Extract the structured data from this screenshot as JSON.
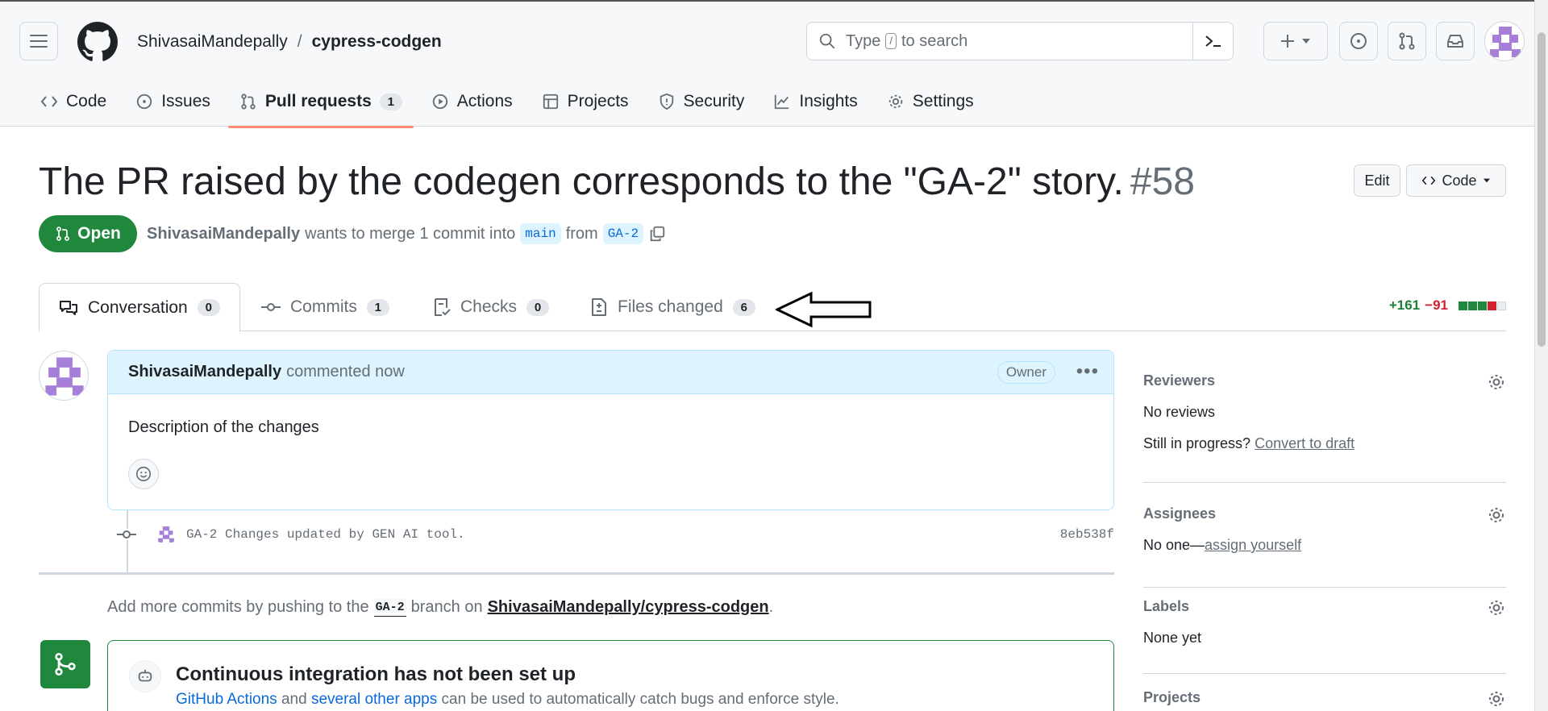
{
  "header": {
    "owner": "ShivasaiMandepally",
    "separator": "/",
    "repo": "cypress-codgen",
    "search": {
      "prefix": "Type",
      "key": "/",
      "suffix": "to search"
    }
  },
  "repo_nav": [
    {
      "label": "Code"
    },
    {
      "label": "Issues"
    },
    {
      "label": "Pull requests",
      "count": "1"
    },
    {
      "label": "Actions"
    },
    {
      "label": "Projects"
    },
    {
      "label": "Security"
    },
    {
      "label": "Insights"
    },
    {
      "label": "Settings"
    }
  ],
  "pr": {
    "title": "The PR raised by the codegen corresponds to the \"GA-2\" story.",
    "number": "#58",
    "edit_label": "Edit",
    "code_label": "Code",
    "state": "Open",
    "author": "ShivasaiMandepally",
    "merge_text": "wants to merge 1 commit into",
    "base": "main",
    "from_text": "from",
    "head": "GA-2"
  },
  "tabs": {
    "conversation": {
      "label": "Conversation",
      "count": "0"
    },
    "commits": {
      "label": "Commits",
      "count": "1"
    },
    "checks": {
      "label": "Checks",
      "count": "0"
    },
    "files": {
      "label": "Files changed",
      "count": "6"
    }
  },
  "diffstat": {
    "added": "+161",
    "removed": "−91"
  },
  "comment": {
    "author": "ShivasaiMandepally",
    "time": "commented now",
    "badge": "Owner",
    "body": "Description of the changes"
  },
  "commit": {
    "message": "GA-2 Changes updated by GEN AI tool.",
    "sha": "8eb538f"
  },
  "push_note": {
    "pre": "Add more commits by pushing to the",
    "branch": "GA-2",
    "mid": "branch on",
    "repo": "ShivasaiMandepally/cypress-codgen",
    "end": "."
  },
  "ci": {
    "title": "Continuous integration has not been set up",
    "link1": "GitHub Actions",
    "and": "and",
    "link2": "several other apps",
    "rest": "can be used to automatically catch bugs and enforce style."
  },
  "sidebar": {
    "reviewers": {
      "title": "Reviewers",
      "value": "No reviews",
      "progress": "Still in progress?",
      "draft_link": "Convert to draft"
    },
    "assignees": {
      "title": "Assignees",
      "value": "No one—",
      "link": "assign yourself"
    },
    "labels": {
      "title": "Labels",
      "value": "None yet"
    },
    "projects": {
      "title": "Projects"
    }
  },
  "colors": {
    "open_green": "#1f883d",
    "link_blue": "#0969da",
    "tab_underline": "#fd8c73",
    "add": "#1a7f37",
    "del": "#cf222e"
  }
}
